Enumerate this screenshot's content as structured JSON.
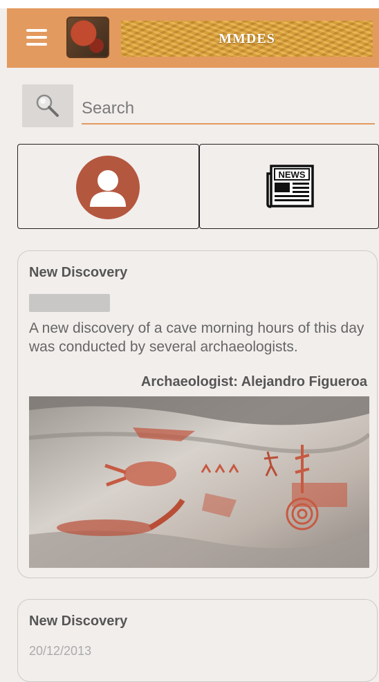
{
  "app": {
    "brand": "MMDES"
  },
  "search": {
    "placeholder": "Search"
  },
  "tiles": [
    {
      "name": "profile",
      "icon": "profile-icon"
    },
    {
      "name": "news",
      "icon": "news-icon",
      "label": "NEWS"
    }
  ],
  "posts": [
    {
      "title": "New Discovery",
      "date": "",
      "description": "A new discovery of a cave morning hours of this day was conducted by several archaeologists.",
      "author": "Archaeologist: Alejandro Figueroa"
    },
    {
      "title": "New Discovery",
      "date": "20/12/2013"
    }
  ],
  "colors": {
    "appbar": "#e39a5f",
    "accent": "#e39a5f",
    "background": "#f2eeec",
    "profile": "#b4573f"
  }
}
